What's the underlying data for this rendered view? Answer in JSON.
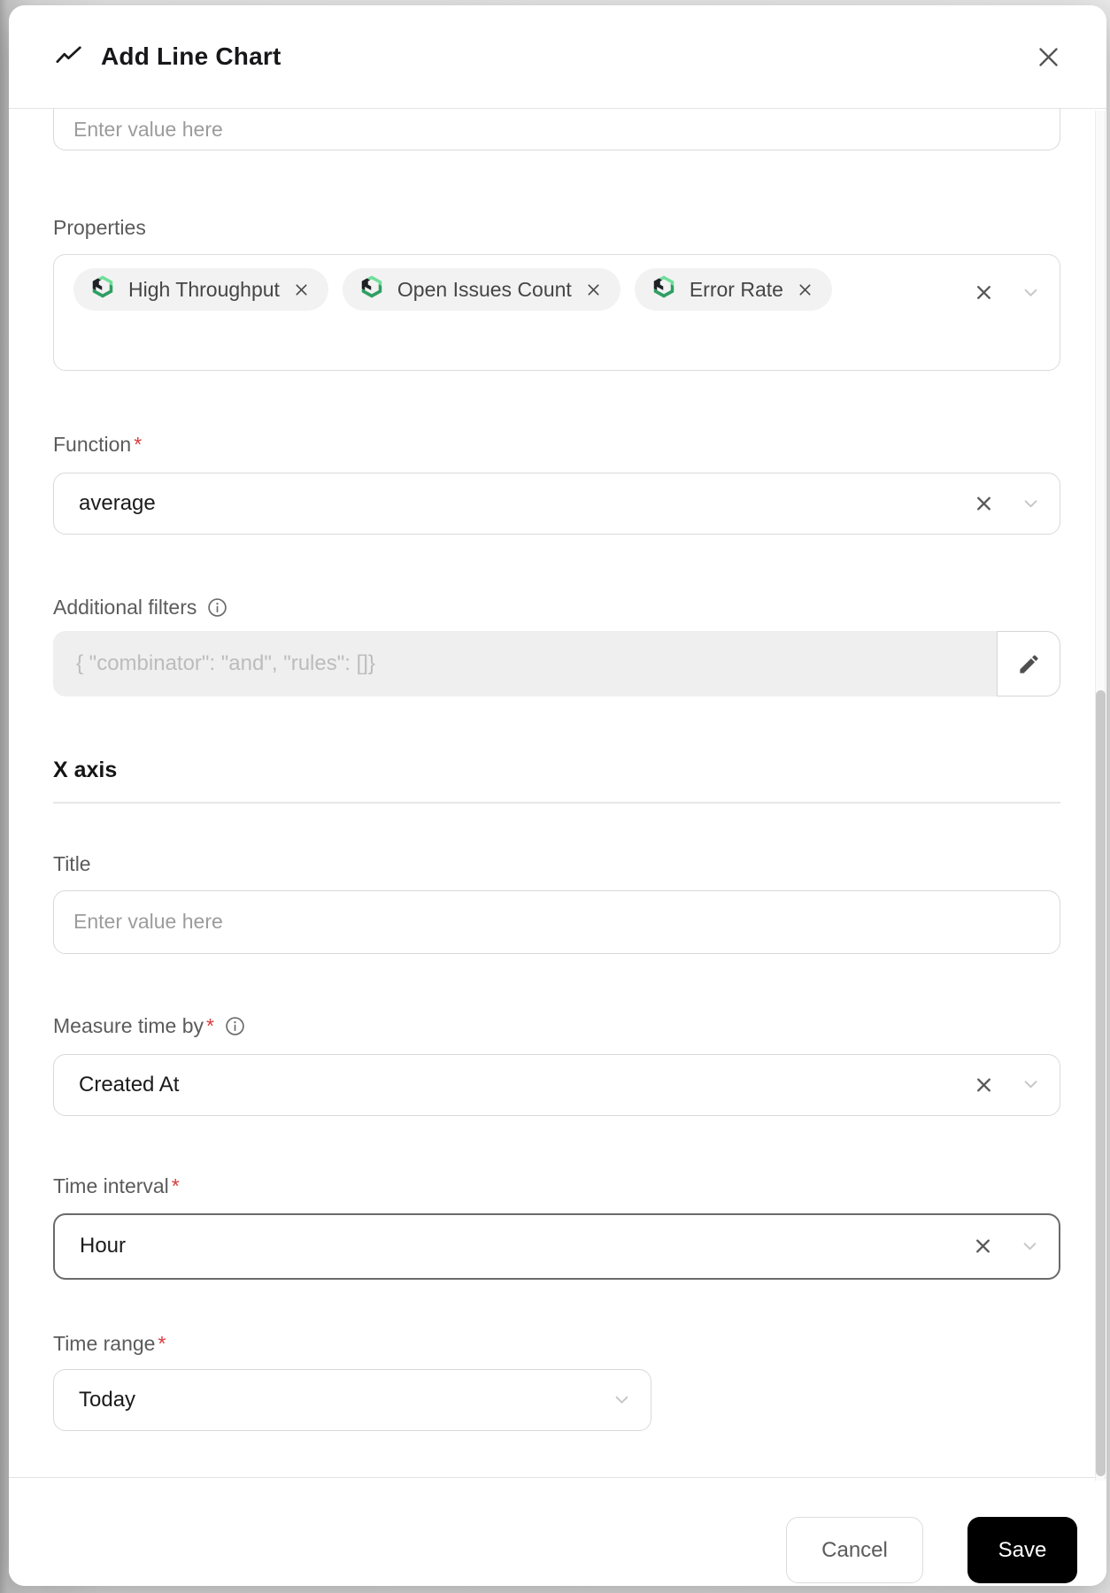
{
  "header": {
    "title": "Add Line Chart",
    "icon": "line-chart-icon"
  },
  "body": {
    "value_input": {
      "placeholder": "Enter value here"
    },
    "properties": {
      "label": "Properties",
      "chips": [
        {
          "label": "High Throughput",
          "icon": "blueprint-cube-icon"
        },
        {
          "label": "Open Issues Count",
          "icon": "blueprint-cube-icon"
        },
        {
          "label": "Error Rate",
          "icon": "blueprint-cube-icon"
        }
      ]
    },
    "function": {
      "label": "Function",
      "required_mark": "*",
      "value": "average"
    },
    "additional_filters": {
      "label": "Additional filters",
      "placeholder": "{ \"combinator\": \"and\",  \"rules\": []}"
    },
    "x_axis_section": {
      "heading": "X axis"
    },
    "title_field": {
      "label": "Title",
      "placeholder": "Enter value here"
    },
    "measure_time_by": {
      "label": "Measure time by",
      "required_mark": "*",
      "value": "Created At"
    },
    "time_interval": {
      "label": "Time interval",
      "required_mark": "*",
      "value": "Hour"
    },
    "time_range": {
      "label": "Time range",
      "required_mark": "*",
      "value": "Today"
    }
  },
  "footer": {
    "cancel_label": "Cancel",
    "save_label": "Save"
  },
  "colors": {
    "brand_green_light": "#70de9a",
    "brand_green_dark": "#2f9e63",
    "brand_black": "#1d2125",
    "required_red": "#d93b3e",
    "save_button_bg": "#000000"
  }
}
